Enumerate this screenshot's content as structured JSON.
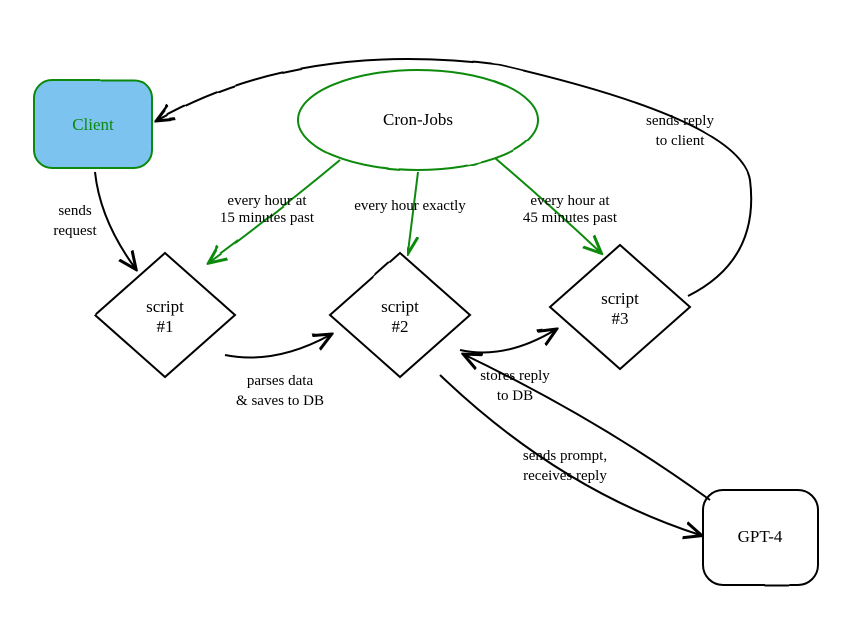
{
  "nodes": {
    "client": "Client",
    "cron": "Cron-Jobs",
    "script1_line1": "script",
    "script1_line2": "#1",
    "script2_line1": "script",
    "script2_line2": "#2",
    "script3_line1": "script",
    "script3_line2": "#3",
    "gpt4": "GPT-4"
  },
  "edges": {
    "sends_request_line1": "sends",
    "sends_request_line2": "request",
    "parses_line1": "parses data",
    "parses_line2": "& saves to DB",
    "stores_line1": "stores reply",
    "stores_line2": "to DB",
    "sends_reply_line1": "sends reply",
    "sends_reply_line2": "to client",
    "prompt_line1": "sends prompt,",
    "prompt_line2": "receives reply",
    "cron1_line1": "every hour at",
    "cron1_line2": "15 minutes past",
    "cron2": "every hour exactly",
    "cron3_line1": "every hour at",
    "cron3_line2": "45 minutes past"
  }
}
